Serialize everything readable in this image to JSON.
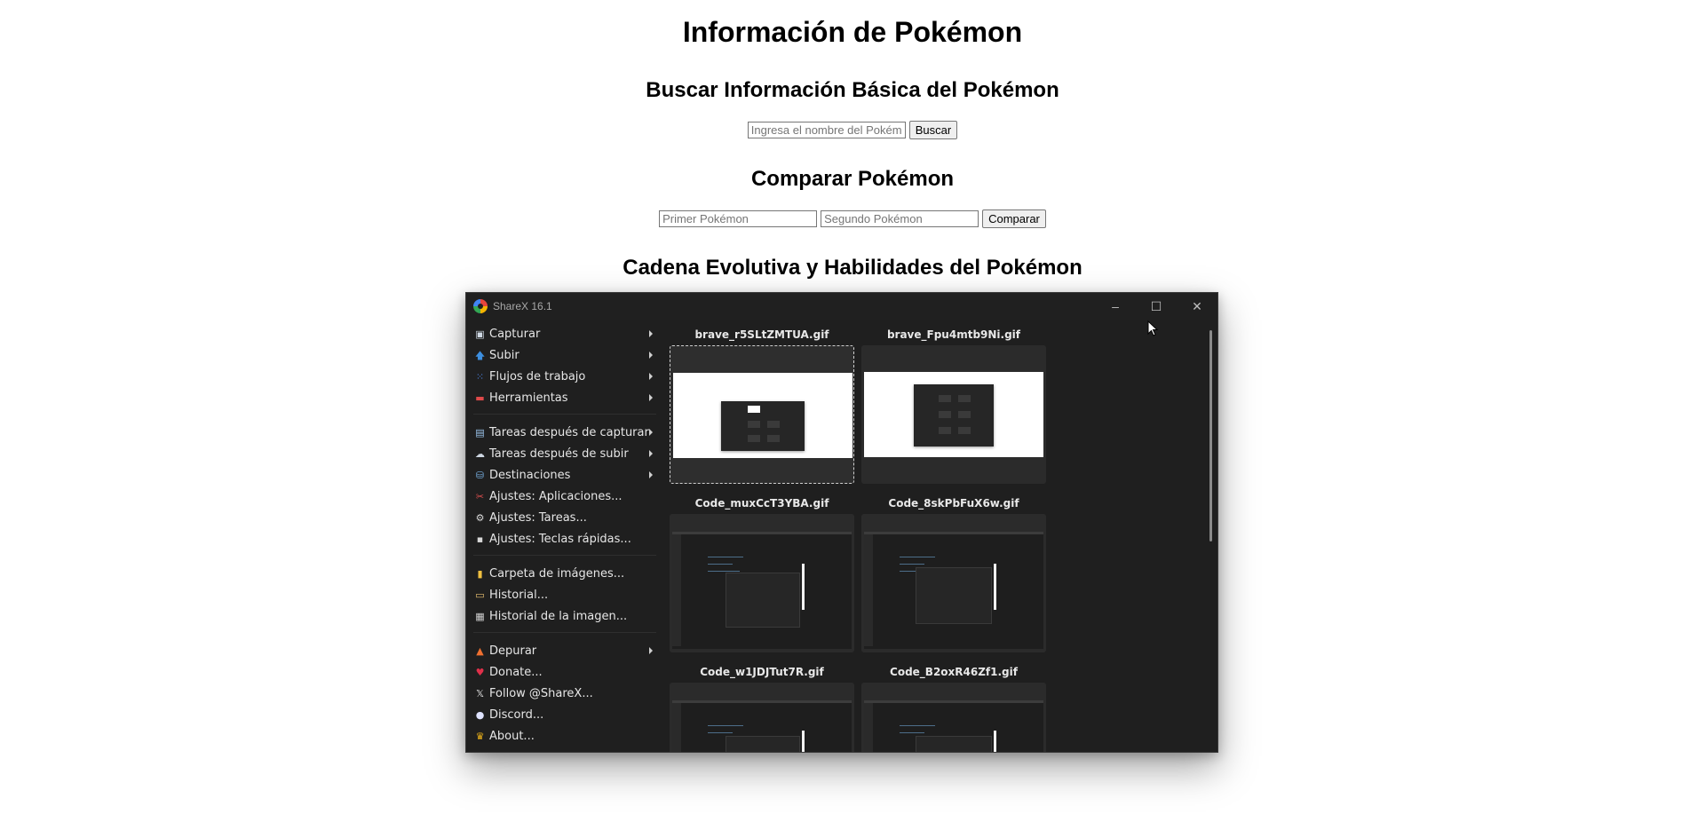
{
  "page": {
    "title": "Información de Pokémon",
    "basic_section": {
      "heading": "Buscar Información Básica del Pokémon",
      "input_placeholder": "Ingresa el nombre del Pokémon",
      "button": "Buscar"
    },
    "compare_section": {
      "heading": "Comparar Pokémon",
      "first_placeholder": "Primer Pokémon",
      "second_placeholder": "Segundo Pokémon",
      "button": "Comparar"
    },
    "evolution_section": {
      "heading": "Cadena Evolutiva y Habilidades del Pokémon"
    }
  },
  "sharex": {
    "title": "ShareX 16.1",
    "controls": {
      "minimize": "–",
      "maximize": "☐",
      "close": "✕"
    },
    "menu": [
      {
        "label": "Capturar",
        "icon": "capture-icon",
        "submenu": true
      },
      {
        "label": "Subir",
        "icon": "upload-arrow-icon",
        "submenu": true
      },
      {
        "label": "Flujos de trabajo",
        "icon": "workflows-icon",
        "submenu": true
      },
      {
        "label": "Herramientas",
        "icon": "tools-icon",
        "submenu": true
      },
      {
        "label": "Tareas después de capturar",
        "icon": "after-capture-icon",
        "submenu": true
      },
      {
        "label": "Tareas después de subir",
        "icon": "after-upload-icon",
        "submenu": true
      },
      {
        "label": "Destinaciones",
        "icon": "destinations-icon",
        "submenu": true
      },
      {
        "label": "Ajustes: Aplicaciones...",
        "icon": "app-settings-icon",
        "submenu": false
      },
      {
        "label": "Ajustes: Tareas...",
        "icon": "task-settings-icon",
        "submenu": false
      },
      {
        "label": "Ajustes: Teclas rápidas...",
        "icon": "hotkey-settings-icon",
        "submenu": false
      },
      {
        "label": "Carpeta de imágenes...",
        "icon": "image-folder-icon",
        "submenu": false
      },
      {
        "label": "Historial...",
        "icon": "history-icon",
        "submenu": false
      },
      {
        "label": "Historial de la imagen...",
        "icon": "image-history-icon",
        "submenu": false
      },
      {
        "label": "Depurar",
        "icon": "debug-icon",
        "submenu": true
      },
      {
        "label": "Donate...",
        "icon": "heart-icon",
        "submenu": false
      },
      {
        "label": "Follow @ShareX...",
        "icon": "x-logo-icon",
        "submenu": false
      },
      {
        "label": "Discord...",
        "icon": "discord-icon",
        "submenu": false
      },
      {
        "label": "About...",
        "icon": "crown-icon",
        "submenu": false
      }
    ],
    "files": [
      {
        "name": "brave_r5SLtZMTUA.gif",
        "kind": "browser",
        "selected": true
      },
      {
        "name": "brave_Fpu4mtb9Ni.gif",
        "kind": "browser",
        "selected": false
      },
      {
        "name": "Code_muxCcT3YBA.gif",
        "kind": "code",
        "selected": false
      },
      {
        "name": "Code_8skPbFuX6w.gif",
        "kind": "code",
        "selected": false
      },
      {
        "name": "Code_w1JDJTut7R.gif",
        "kind": "code",
        "selected": false
      },
      {
        "name": "Code_B2oxR46Zf1.gif",
        "kind": "code",
        "selected": false
      }
    ]
  }
}
